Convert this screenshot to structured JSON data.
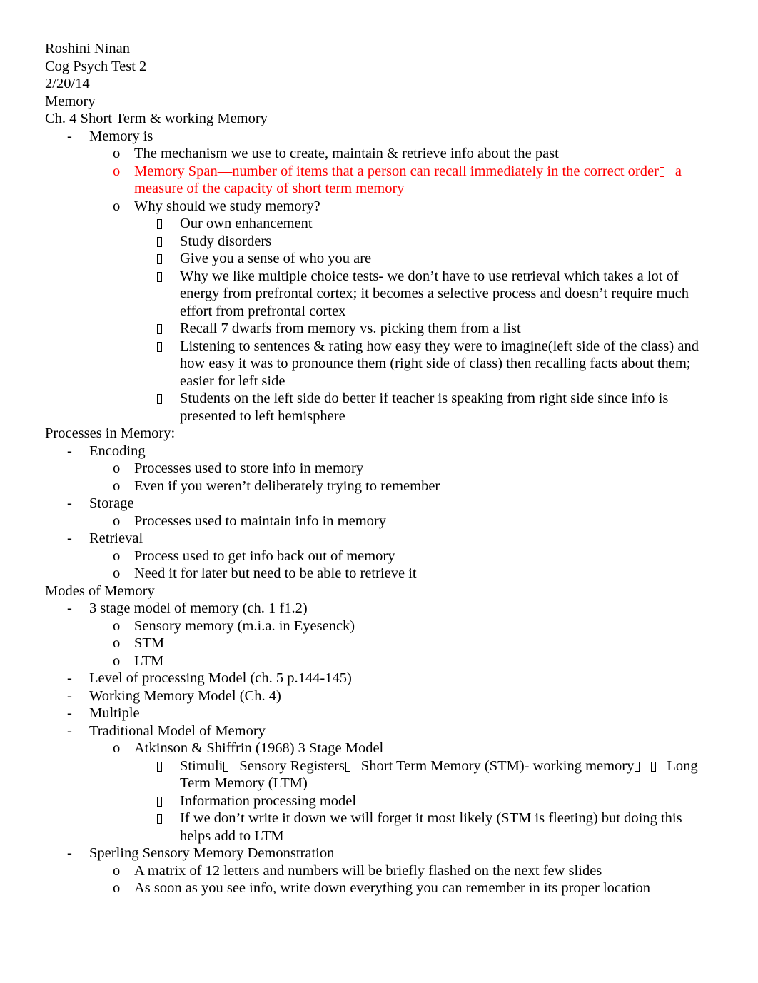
{
  "document": {
    "header": {
      "author": "Roshini Ninan",
      "course": "Cog Psych Test 2",
      "date": "2/20/14",
      "topic": "Memory",
      "chapter": "Ch. 4 Short Term & working Memory"
    },
    "section_memory_is": {
      "heading": "Memory is",
      "items": {
        "mechanism": "The mechanism we use to create, maintain & retrieve info about the past",
        "memory_span_part1": "Memory Span—number of items that a person can recall immediately in the correct order",
        "memory_span_part2": "a measure of the capacity of short term memory",
        "why_study": "Why should we study memory?"
      },
      "why_study_points": [
        "Our own enhancement",
        "Study disorders",
        "Give you a sense of who you are",
        "Why we like multiple choice tests- we don’t have to use retrieval which takes a lot of energy from prefrontal cortex; it becomes a selective process and doesn’t require much effort from prefrontal cortex",
        "Recall 7 dwarfs from memory vs. picking them from a list",
        "Listening to sentences & rating how easy they were to imagine(left side of the class) and how easy it was to pronounce them (right side of class) then recalling facts about them; easier for left side",
        "Students on the left side do better if teacher is speaking from right side since info is presented to left hemisphere"
      ]
    },
    "section_processes": {
      "heading": "Processes in Memory:",
      "encoding": {
        "label": "Encoding",
        "points": [
          "Processes used to store info in memory",
          "Even if you weren’t deliberately trying to remember"
        ]
      },
      "storage": {
        "label": "Storage",
        "points": [
          "Processes used to maintain info in memory"
        ]
      },
      "retrieval": {
        "label": "Retrieval",
        "points": [
          "Process used to get info back out of memory",
          "Need it for later but need to be able to retrieve it"
        ]
      }
    },
    "section_modes": {
      "heading": "Modes of Memory",
      "three_stage": {
        "label": "3 stage model of memory (ch. 1 f1.2)",
        "points": [
          "Sensory memory (m.i.a. in Eyesenck)",
          "STM",
          "LTM"
        ]
      },
      "other_models": [
        "Level of processing Model (ch. 5 p.144-145)",
        "Working Memory Model (Ch. 4)",
        "Multiple"
      ],
      "traditional": {
        "label": "Traditional Model of Memory",
        "atkinson": "Atkinson & Shiffrin (1968) 3 Stage Model",
        "stimuli_chain": {
          "part1": "Stimuli",
          "part2": "Sensory Registers",
          "part3": "Short Term Memory (STM)- working memory",
          "part4": "Long Term Memory (LTM)"
        },
        "points": [
          "Information processing model",
          "If we don’t write it down we will forget it most likely (STM is fleeting) but doing this helps add to LTM"
        ]
      },
      "sperling": {
        "label": "Sperling Sensory Memory Demonstration",
        "points": [
          "A matrix of 12 letters and numbers will be briefly flashed on the next few slides",
          "As soon as you see info, write down everything you can remember in its proper location"
        ]
      }
    },
    "markers": {
      "dash": "-",
      "circle": "o"
    },
    "colors": {
      "highlight_red": "#ff0000",
      "body_text": "#000000",
      "page_background": "#ffffff"
    }
  }
}
